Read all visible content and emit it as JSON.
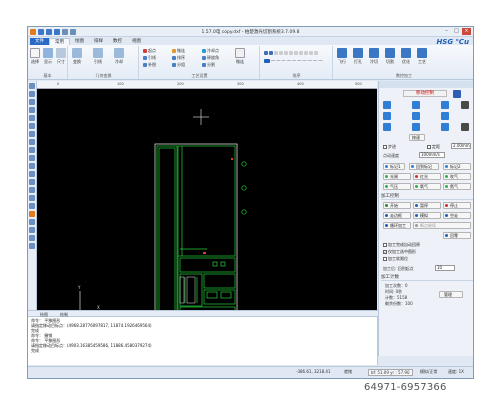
{
  "title": "1.57.0电 copy.dxf - 柏楚激光切割系统3.7.09.8",
  "tabs": [
    "文件",
    "常用",
    "绘图",
    "排样",
    "数控",
    "视图"
  ],
  "brand": "HSG ℃u",
  "ribbon": {
    "groups": [
      {
        "label": "基本"
      },
      {
        "label": "几何变换"
      },
      {
        "label": "工艺设置"
      },
      {
        "label": "排序"
      },
      {
        "label": "数控加工"
      }
    ],
    "buttons": [
      "选择",
      "显示",
      "尺寸",
      "变换",
      "引线",
      "冷却",
      "微连",
      "反向",
      "封口",
      "阳切",
      "补偿",
      "刷新",
      "群组",
      "飞行",
      "打孔",
      "冷切",
      "切割",
      "优化",
      "工艺"
    ],
    "small_rows": [
      "起点",
      "引线",
      "补偿",
      "微连",
      "排序",
      "分组",
      "冷却点",
      "释放角",
      "分割"
    ]
  },
  "ruler_labels": [
    "0",
    "100",
    "200",
    "300",
    "400",
    "500"
  ],
  "right_panel": {
    "header": "移动控制",
    "move_button": "移动至桶中",
    "step_label": "按速",
    "check_labels": [
      "步进",
      "定距",
      "2.00mm"
    ],
    "tool_width": "点动速度",
    "tool_width_value": "100mm/s",
    "mark_buttons": [
      "标记1",
      "回到标记",
      "标记2"
    ],
    "io_buttons": [
      {
        "label": "光闸",
        "color": "#2ab34a"
      },
      {
        "label": "红光",
        "color": "#d12c2c"
      },
      {
        "label": "吹气",
        "color": "#2ab34a"
      },
      {
        "label": "气压",
        "color": "#2ab34a"
      },
      {
        "label": "氧气",
        "color": "#2ab34a"
      },
      {
        "label": "氮气",
        "color": "#2ab34a"
      }
    ],
    "process_header": "加工控制",
    "process_buttons": [
      {
        "label": "开始",
        "icon_color": "#2a8a2a"
      },
      {
        "label": "暂停",
        "icon_color": "#1f5fb8"
      },
      {
        "label": "停止",
        "icon_color": "#d12c2c"
      },
      {
        "label": "走边框",
        "icon_color": "#1f5fb8"
      },
      {
        "label": "模拟",
        "icon_color": "#1f5fb8"
      },
      {
        "label": "空走",
        "icon_color": "#1f5fb8"
      },
      {
        "label": "循环加工",
        "icon_color": "#1f5fb8"
      },
      {
        "label": "断点继续",
        "icon_color": "#999999"
      },
      {
        "label": "回零",
        "icon_color": "#1f5fb8"
      }
    ],
    "options": [
      {
        "label": "加工完成自动回原",
        "checked": false
      },
      {
        "label": "仅加工选中图形",
        "checked": true
      },
      {
        "label": "加工软限位",
        "checked": false
      }
    ],
    "return_label": "加工后: 回到起点",
    "return_value": "10",
    "count_header": "加工计数",
    "count_lines": [
      "加工次数：0",
      "时间: 0秒",
      "计数：5158",
      "剩余份数：100"
    ],
    "manage_button": "管理"
  },
  "bottom_tabs": [
    "绘图",
    "绘制"
  ],
  "log_lines": [
    "命令：  平移图形",
    "请指定移动目标点：(4968.28776097817, 11874.1926469564)",
    "完成",
    "命令：  撤销",
    "命令：  平移图形",
    "请指定移动目标点：(4903.16385459586, 11886.4580379274)",
    "完成"
  ],
  "status": {
    "coords": "-386.61, 3218.41",
    "mode": "就绪",
    "bf": "bf: 51.09 yr : 57.90",
    "sim": "模拟/正常",
    "speed": "速度: 1X"
  },
  "watermark": "64971-6957366"
}
